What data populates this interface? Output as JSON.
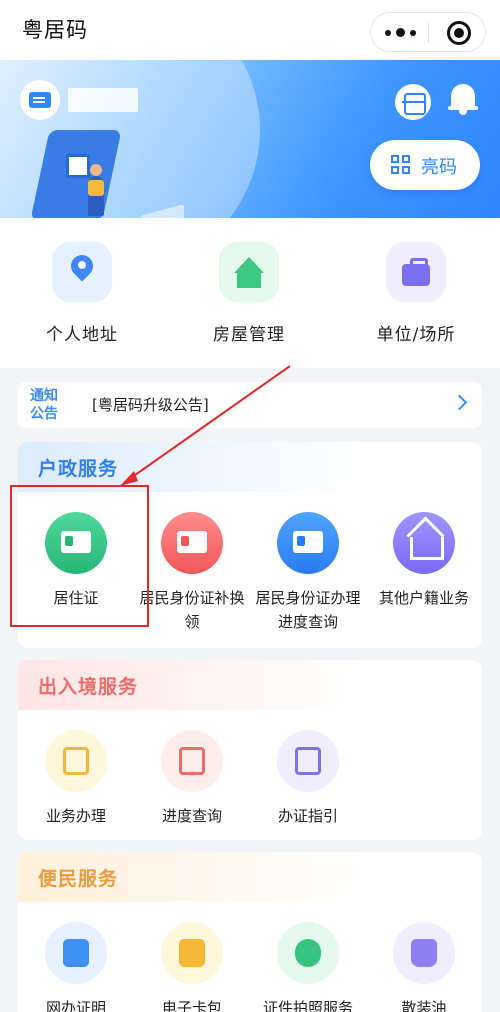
{
  "app": {
    "title": "粤居码"
  },
  "capsule": {
    "more_icon": "more-dots-icon",
    "close_icon": "target-close-icon"
  },
  "banner": {
    "show_code_label": "亮码",
    "icons": [
      "id-card-icon",
      "scan-icon",
      "bell-icon",
      "qr-code-icon"
    ]
  },
  "quick_actions": [
    {
      "label": "个人地址",
      "icon": "location-pin-icon"
    },
    {
      "label": "房屋管理",
      "icon": "house-icon"
    },
    {
      "label": "单位/场所",
      "icon": "briefcase-icon"
    }
  ],
  "notice": {
    "tag": "通知公告",
    "text": "[粤居码升级公告]"
  },
  "huzheng": {
    "title": "户政服务",
    "items": [
      {
        "label": "居住证",
        "icon": "residence-card-icon"
      },
      {
        "label": "居民身份证补换领",
        "icon": "id-card-renew-icon"
      },
      {
        "label": "居民身份证办理进度查询",
        "icon": "id-card-progress-icon"
      },
      {
        "label": "其他户籍业务",
        "icon": "household-home-icon"
      }
    ]
  },
  "churujing": {
    "title": "出入境服务",
    "items": [
      {
        "label": "业务办理",
        "icon": "document-tray-icon"
      },
      {
        "label": "进度查询",
        "icon": "document-x-icon"
      },
      {
        "label": "办证指引",
        "icon": "guide-list-icon"
      }
    ]
  },
  "bianmin": {
    "title": "便民服务",
    "items": [
      {
        "label": "网办证明",
        "icon": "online-certificate-icon"
      },
      {
        "label": "电子卡包",
        "icon": "wallet-icon"
      },
      {
        "label": "证件拍照服务",
        "icon": "camera-id-icon"
      },
      {
        "label": "散装油",
        "icon": "oil-bottle-icon"
      }
    ]
  },
  "colors": {
    "accent_blue": "#2f86ff",
    "annotation_red": "#e0292b"
  }
}
